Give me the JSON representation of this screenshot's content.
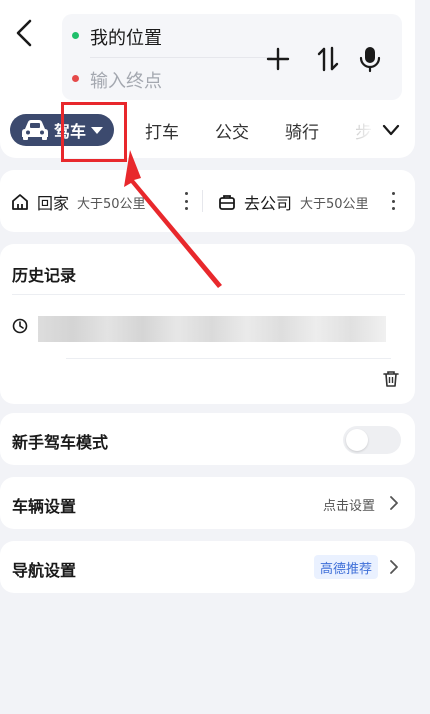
{
  "route": {
    "start_label": "我的位置",
    "end_placeholder": "输入终点"
  },
  "tools": {
    "add_icon": "plus-icon",
    "swap_icon": "swap-icon",
    "voice_icon": "microphone-icon"
  },
  "modes": {
    "active_label": "驾车",
    "tabs": [
      "打车",
      "公交",
      "骑行",
      "步"
    ]
  },
  "places": [
    {
      "name": "回家",
      "distance": "大于50公里"
    },
    {
      "name": "去公司",
      "distance": "大于50公里"
    }
  ],
  "history": {
    "title": "历史记录"
  },
  "rows": {
    "novice_mode": {
      "title": "新手驾车模式"
    },
    "vehicle_settings": {
      "title": "车辆设置",
      "value": "点击设置"
    },
    "nav_settings": {
      "title": "导航设置",
      "badge": "高德推荐"
    }
  },
  "colors": {
    "accent_dark": "#3c4a6e",
    "annotation_red": "#e8282c",
    "badge_blue": "#3f6fd8"
  }
}
